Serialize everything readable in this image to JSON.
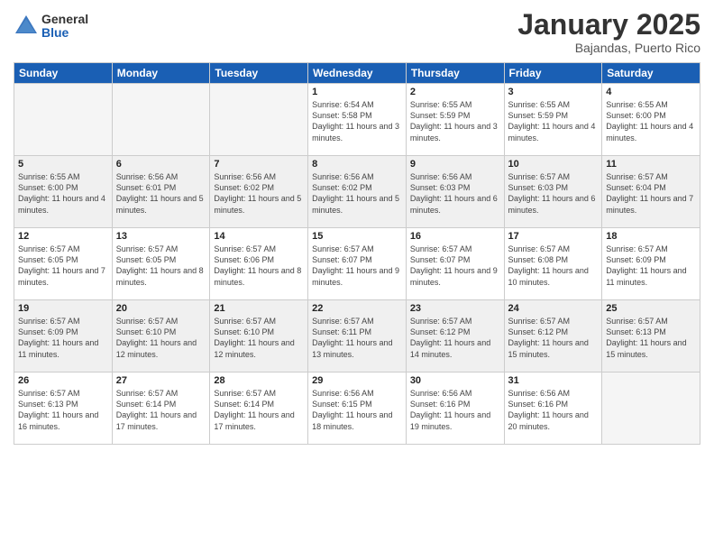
{
  "logo": {
    "general": "General",
    "blue": "Blue"
  },
  "title": "January 2025",
  "location": "Bajandas, Puerto Rico",
  "weekdays": [
    "Sunday",
    "Monday",
    "Tuesday",
    "Wednesday",
    "Thursday",
    "Friday",
    "Saturday"
  ],
  "weeks": [
    {
      "shaded": false,
      "days": [
        {
          "num": "",
          "empty": true
        },
        {
          "num": "",
          "empty": true
        },
        {
          "num": "",
          "empty": true
        },
        {
          "num": "1",
          "sunrise": "Sunrise: 6:54 AM",
          "sunset": "Sunset: 5:58 PM",
          "daylight": "Daylight: 11 hours and 3 minutes."
        },
        {
          "num": "2",
          "sunrise": "Sunrise: 6:55 AM",
          "sunset": "Sunset: 5:59 PM",
          "daylight": "Daylight: 11 hours and 3 minutes."
        },
        {
          "num": "3",
          "sunrise": "Sunrise: 6:55 AM",
          "sunset": "Sunset: 5:59 PM",
          "daylight": "Daylight: 11 hours and 4 minutes."
        },
        {
          "num": "4",
          "sunrise": "Sunrise: 6:55 AM",
          "sunset": "Sunset: 6:00 PM",
          "daylight": "Daylight: 11 hours and 4 minutes."
        }
      ]
    },
    {
      "shaded": true,
      "days": [
        {
          "num": "5",
          "sunrise": "Sunrise: 6:55 AM",
          "sunset": "Sunset: 6:00 PM",
          "daylight": "Daylight: 11 hours and 4 minutes."
        },
        {
          "num": "6",
          "sunrise": "Sunrise: 6:56 AM",
          "sunset": "Sunset: 6:01 PM",
          "daylight": "Daylight: 11 hours and 5 minutes."
        },
        {
          "num": "7",
          "sunrise": "Sunrise: 6:56 AM",
          "sunset": "Sunset: 6:02 PM",
          "daylight": "Daylight: 11 hours and 5 minutes."
        },
        {
          "num": "8",
          "sunrise": "Sunrise: 6:56 AM",
          "sunset": "Sunset: 6:02 PM",
          "daylight": "Daylight: 11 hours and 5 minutes."
        },
        {
          "num": "9",
          "sunrise": "Sunrise: 6:56 AM",
          "sunset": "Sunset: 6:03 PM",
          "daylight": "Daylight: 11 hours and 6 minutes."
        },
        {
          "num": "10",
          "sunrise": "Sunrise: 6:57 AM",
          "sunset": "Sunset: 6:03 PM",
          "daylight": "Daylight: 11 hours and 6 minutes."
        },
        {
          "num": "11",
          "sunrise": "Sunrise: 6:57 AM",
          "sunset": "Sunset: 6:04 PM",
          "daylight": "Daylight: 11 hours and 7 minutes."
        }
      ]
    },
    {
      "shaded": false,
      "days": [
        {
          "num": "12",
          "sunrise": "Sunrise: 6:57 AM",
          "sunset": "Sunset: 6:05 PM",
          "daylight": "Daylight: 11 hours and 7 minutes."
        },
        {
          "num": "13",
          "sunrise": "Sunrise: 6:57 AM",
          "sunset": "Sunset: 6:05 PM",
          "daylight": "Daylight: 11 hours and 8 minutes."
        },
        {
          "num": "14",
          "sunrise": "Sunrise: 6:57 AM",
          "sunset": "Sunset: 6:06 PM",
          "daylight": "Daylight: 11 hours and 8 minutes."
        },
        {
          "num": "15",
          "sunrise": "Sunrise: 6:57 AM",
          "sunset": "Sunset: 6:07 PM",
          "daylight": "Daylight: 11 hours and 9 minutes."
        },
        {
          "num": "16",
          "sunrise": "Sunrise: 6:57 AM",
          "sunset": "Sunset: 6:07 PM",
          "daylight": "Daylight: 11 hours and 9 minutes."
        },
        {
          "num": "17",
          "sunrise": "Sunrise: 6:57 AM",
          "sunset": "Sunset: 6:08 PM",
          "daylight": "Daylight: 11 hours and 10 minutes."
        },
        {
          "num": "18",
          "sunrise": "Sunrise: 6:57 AM",
          "sunset": "Sunset: 6:09 PM",
          "daylight": "Daylight: 11 hours and 11 minutes."
        }
      ]
    },
    {
      "shaded": true,
      "days": [
        {
          "num": "19",
          "sunrise": "Sunrise: 6:57 AM",
          "sunset": "Sunset: 6:09 PM",
          "daylight": "Daylight: 11 hours and 11 minutes."
        },
        {
          "num": "20",
          "sunrise": "Sunrise: 6:57 AM",
          "sunset": "Sunset: 6:10 PM",
          "daylight": "Daylight: 11 hours and 12 minutes."
        },
        {
          "num": "21",
          "sunrise": "Sunrise: 6:57 AM",
          "sunset": "Sunset: 6:10 PM",
          "daylight": "Daylight: 11 hours and 12 minutes."
        },
        {
          "num": "22",
          "sunrise": "Sunrise: 6:57 AM",
          "sunset": "Sunset: 6:11 PM",
          "daylight": "Daylight: 11 hours and 13 minutes."
        },
        {
          "num": "23",
          "sunrise": "Sunrise: 6:57 AM",
          "sunset": "Sunset: 6:12 PM",
          "daylight": "Daylight: 11 hours and 14 minutes."
        },
        {
          "num": "24",
          "sunrise": "Sunrise: 6:57 AM",
          "sunset": "Sunset: 6:12 PM",
          "daylight": "Daylight: 11 hours and 15 minutes."
        },
        {
          "num": "25",
          "sunrise": "Sunrise: 6:57 AM",
          "sunset": "Sunset: 6:13 PM",
          "daylight": "Daylight: 11 hours and 15 minutes."
        }
      ]
    },
    {
      "shaded": false,
      "days": [
        {
          "num": "26",
          "sunrise": "Sunrise: 6:57 AM",
          "sunset": "Sunset: 6:13 PM",
          "daylight": "Daylight: 11 hours and 16 minutes."
        },
        {
          "num": "27",
          "sunrise": "Sunrise: 6:57 AM",
          "sunset": "Sunset: 6:14 PM",
          "daylight": "Daylight: 11 hours and 17 minutes."
        },
        {
          "num": "28",
          "sunrise": "Sunrise: 6:57 AM",
          "sunset": "Sunset: 6:14 PM",
          "daylight": "Daylight: 11 hours and 17 minutes."
        },
        {
          "num": "29",
          "sunrise": "Sunrise: 6:56 AM",
          "sunset": "Sunset: 6:15 PM",
          "daylight": "Daylight: 11 hours and 18 minutes."
        },
        {
          "num": "30",
          "sunrise": "Sunrise: 6:56 AM",
          "sunset": "Sunset: 6:16 PM",
          "daylight": "Daylight: 11 hours and 19 minutes."
        },
        {
          "num": "31",
          "sunrise": "Sunrise: 6:56 AM",
          "sunset": "Sunset: 6:16 PM",
          "daylight": "Daylight: 11 hours and 20 minutes."
        },
        {
          "num": "",
          "empty": true
        }
      ]
    }
  ]
}
